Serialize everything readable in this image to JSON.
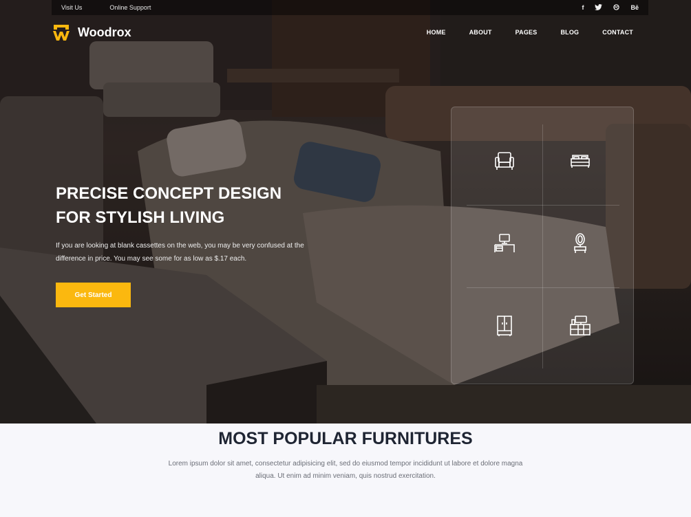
{
  "topbar": {
    "links": [
      "Visit Us",
      "Online Support"
    ],
    "social": [
      "f",
      "t",
      "dribbble",
      "Bē"
    ]
  },
  "brand": {
    "name": "Woodrox"
  },
  "nav": {
    "items": [
      "HOME",
      "ABOUT",
      "PAGES",
      "BLOG",
      "CONTACT"
    ]
  },
  "hero": {
    "title_line1": "PRECISE CONCEPT DESIGN",
    "title_line2": "FOR STYLISH LIVING",
    "desc_line1": "If you are looking at blank cassettes on the web, you may be very confused at the",
    "desc_line2": "difference in price. You may see some for as low as $.17 each.",
    "cta_label": "Get Started"
  },
  "categories": {
    "icons": [
      "armchair-icon",
      "bed-icon",
      "desk-icon",
      "mirror-icon",
      "wardrobe-icon",
      "tv-cabinet-icon"
    ]
  },
  "section": {
    "title": "MOST POPULAR FURNITURES",
    "desc_line1": "Lorem ipsum dolor sit amet, consectetur adipisicing elit, sed do eiusmod tempor incididunt ut labore et dolore magna",
    "desc_line2": "aliqua. Ut enim ad minim veniam, quis nostrud exercitation."
  },
  "colors": {
    "accent": "#fbb80f",
    "heading": "#1f2533",
    "body_text": "#6b6e77"
  }
}
